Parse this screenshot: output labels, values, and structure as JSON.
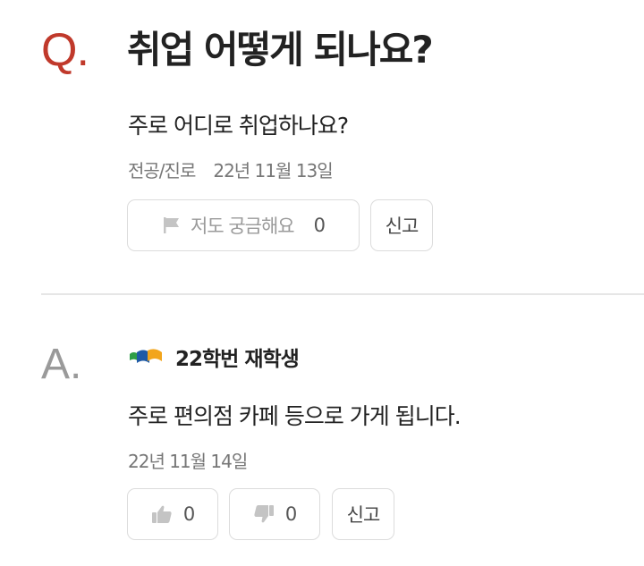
{
  "question": {
    "marker": "Q.",
    "title": "취업 어떻게 되나요?",
    "body": "주로 어디로 취업하나요?",
    "category": "전공/진로",
    "date": "22년 11월 13일",
    "curious_label": "저도 궁금해요",
    "curious_count": "0",
    "report_label": "신고",
    "icons": {
      "curious": "flag-icon"
    }
  },
  "answer": {
    "marker": "A.",
    "author": "22학번 재학생",
    "body": "주로 편의점 카페 등으로 가게 됩니다.",
    "date": "22년 11월 14일",
    "like_count": "0",
    "dislike_count": "0",
    "report_label": "신고",
    "icons": {
      "author": "school-logo-icon",
      "like": "thumbs-up-icon",
      "dislike": "thumbs-down-icon"
    }
  },
  "colors": {
    "q_marker": "#c0392b",
    "a_marker": "#9a9a9a",
    "border": "#dcdcdc",
    "divider": "#e6e6e6",
    "meta_text": "#777777"
  }
}
